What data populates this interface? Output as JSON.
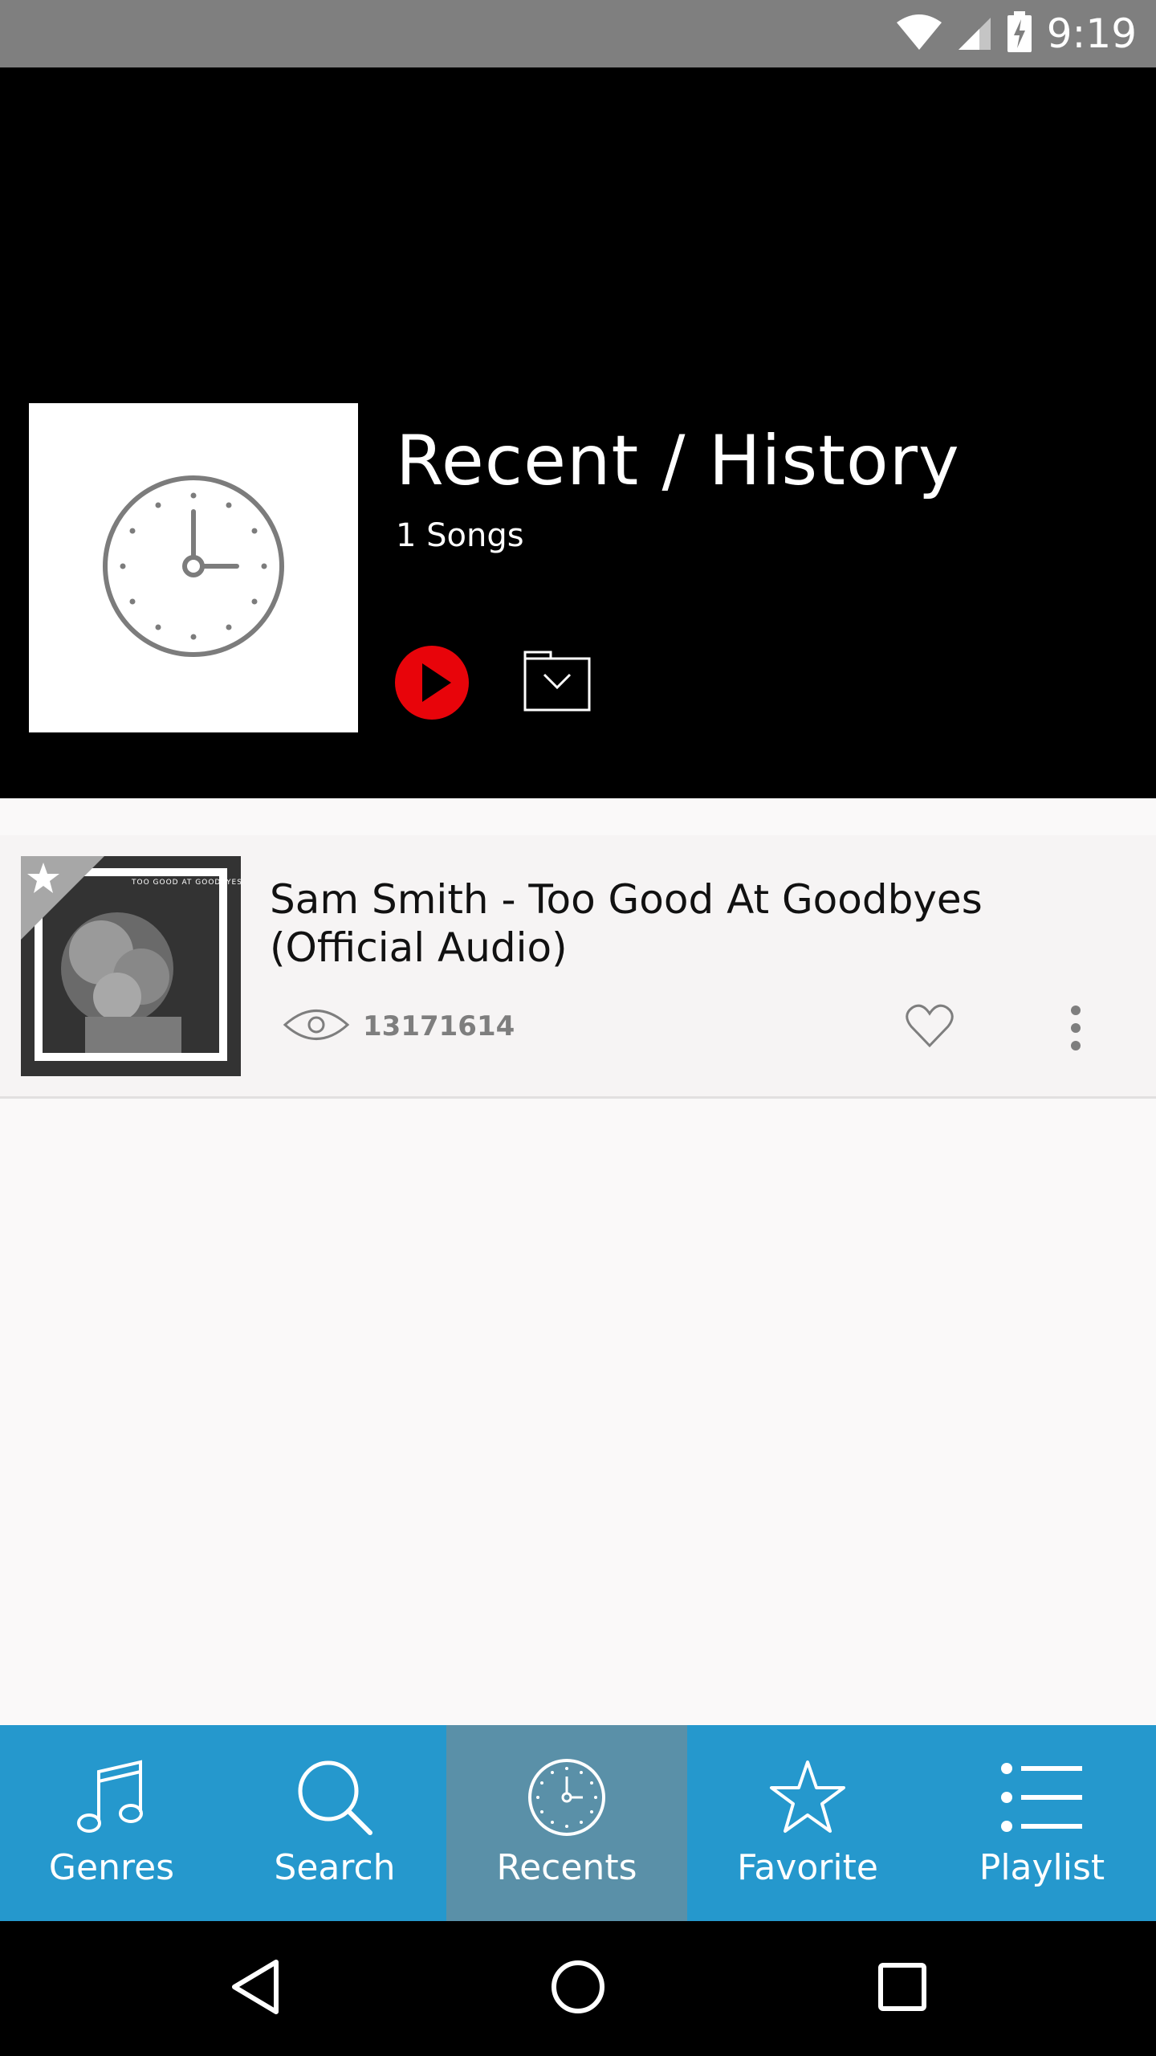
{
  "status_bar": {
    "time": "9:19",
    "icons": [
      "wifi-icon",
      "cell-signal-icon",
      "battery-charging-icon"
    ]
  },
  "header": {
    "cover_icon": "clock-icon",
    "title": "Recent / History",
    "subtitle": "1 Songs",
    "play_icon": "play-icon",
    "save_icon": "folder-download-icon",
    "accent_color": "#e8040a"
  },
  "songs": [
    {
      "title": "Sam Smith - Too Good At Goodbyes (Official Audio)",
      "views": "13171614",
      "thumb_caption": "TOO GOOD AT GOODBYES",
      "thumb_badge_icon": "star-icon",
      "view_icon": "eye-icon",
      "like_icon": "heart-icon",
      "more_icon": "more-vertical-icon"
    }
  ],
  "bottom_nav": {
    "background": "#2598cd",
    "active_background": "#5a90a8",
    "items": [
      {
        "label": "Genres",
        "icon": "music-note-icon",
        "active": false
      },
      {
        "label": "Search",
        "icon": "search-icon",
        "active": false
      },
      {
        "label": "Recents",
        "icon": "clock-icon",
        "active": true
      },
      {
        "label": "Favorite",
        "icon": "star-icon",
        "active": false
      },
      {
        "label": "Playlist",
        "icon": "list-icon",
        "active": false
      }
    ]
  },
  "system_nav": {
    "icons": [
      "back-icon",
      "home-icon",
      "recents-apps-icon"
    ]
  }
}
